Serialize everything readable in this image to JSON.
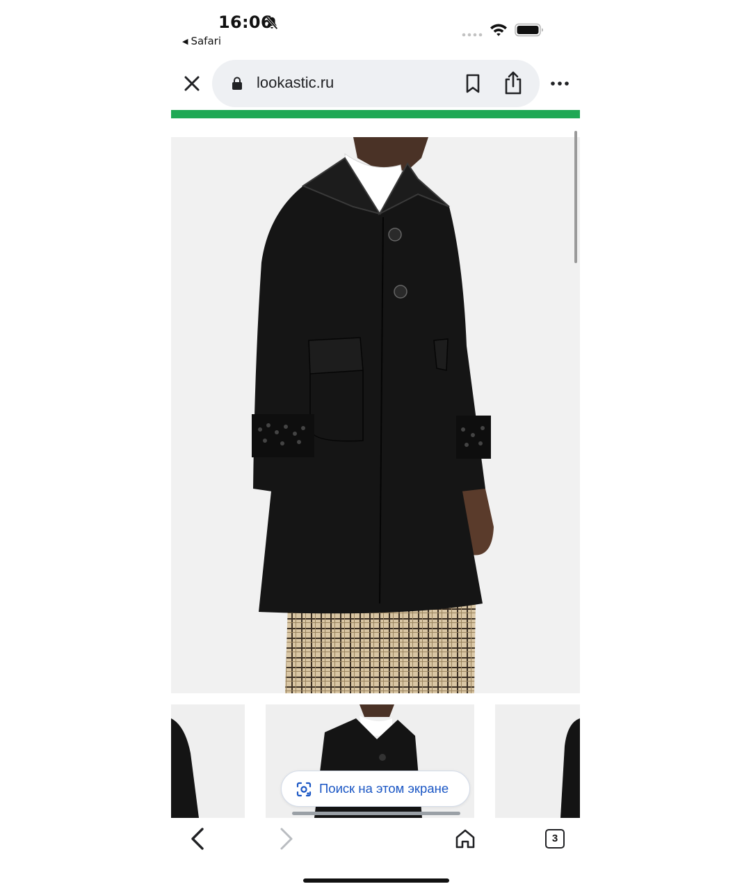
{
  "status_bar": {
    "time": "16:06",
    "back_app": "Safari",
    "icons": [
      "bell-slash-icon",
      "signal-icon",
      "wifi-icon",
      "battery-icon"
    ]
  },
  "browser": {
    "url": "lookastic.ru",
    "icons": [
      "close-icon",
      "lock-icon",
      "bookmark-icon",
      "share-icon",
      "more-icon"
    ],
    "load_progress": 1.0,
    "accent_color": "#1fa855"
  },
  "lens_search": {
    "label": "Поиск на этом экране",
    "color": "#1a56c4"
  },
  "bottom_bar": {
    "tab_count": "3",
    "icons": [
      "chevron-left-icon",
      "chevron-right-icon",
      "home-icon",
      "tabs-icon"
    ]
  }
}
